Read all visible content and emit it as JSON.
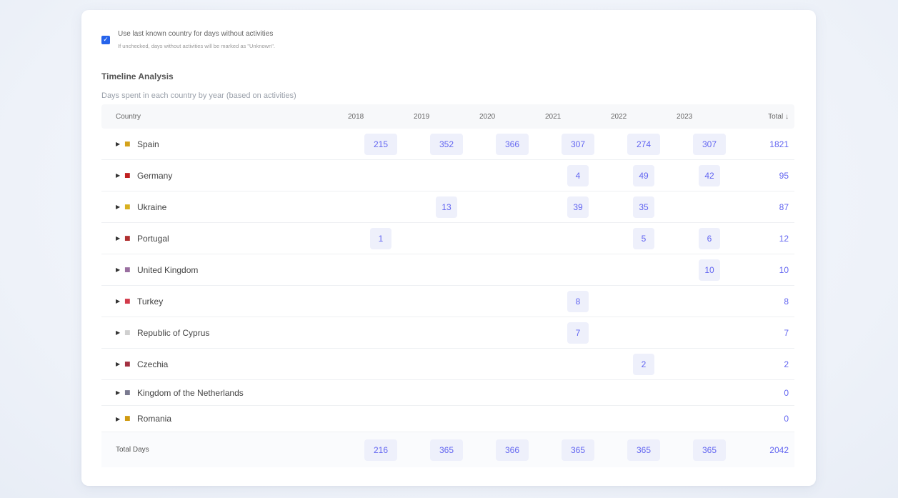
{
  "options": {
    "use_last_known_label": "Use last known country for days without activities",
    "use_last_known_help": "If unchecked, days without activities will be marked as \"Unknown\".",
    "use_last_known_checked": true
  },
  "timeline": {
    "title": "Timeline Analysis",
    "subtitle": "Days spent in each country by year (based on activities)"
  },
  "table": {
    "headers": {
      "country": "Country",
      "years": [
        "2018",
        "2019",
        "2020",
        "2021",
        "2022",
        "2023"
      ],
      "total": "Total ↓"
    },
    "rows": [
      {
        "flag": "■",
        "flag_color": "#d4a21a",
        "country": "Spain",
        "values": [
          "215",
          "352",
          "366",
          "307",
          "274",
          "307"
        ],
        "total": "1821"
      },
      {
        "flag": "■",
        "flag_color": "#c02020",
        "country": "Germany",
        "values": [
          "",
          "",
          "",
          "4",
          "49",
          "42"
        ],
        "total": "95"
      },
      {
        "flag": "■",
        "flag_color": "#d8b020",
        "country": "Ukraine",
        "values": [
          "",
          "13",
          "",
          "39",
          "35",
          ""
        ],
        "total": "87"
      },
      {
        "flag": "■",
        "flag_color": "#b03030",
        "country": "Portugal",
        "values": [
          "1",
          "",
          "",
          "",
          "5",
          "6"
        ],
        "total": "12"
      },
      {
        "flag": "■",
        "flag_color": "#9a6fa0",
        "country": "United Kingdom",
        "values": [
          "",
          "",
          "",
          "",
          "",
          "10"
        ],
        "total": "10"
      },
      {
        "flag": "■",
        "flag_color": "#d23a4a",
        "country": "Turkey",
        "values": [
          "",
          "",
          "",
          "8",
          "",
          ""
        ],
        "total": "8"
      },
      {
        "flag": "■",
        "flag_color": "#d0d0d0",
        "country": "Republic of Cyprus",
        "values": [
          "",
          "",
          "",
          "7",
          "",
          ""
        ],
        "total": "7"
      },
      {
        "flag": "■",
        "flag_color": "#a33040",
        "country": "Czechia",
        "values": [
          "",
          "",
          "",
          "",
          "2",
          ""
        ],
        "total": "2"
      },
      {
        "flag": "■",
        "flag_color": "#7a7a90",
        "country": "Kingdom of the Netherlands",
        "values": [
          "",
          "",
          "",
          "",
          "",
          ""
        ],
        "total": "0"
      },
      {
        "flag": "■",
        "flag_color": "#d09a10",
        "country": "Romania",
        "values": [
          "",
          "",
          "",
          "",
          "",
          ""
        ],
        "total": "0"
      }
    ],
    "footer": {
      "label": "Total Days",
      "values": [
        "216",
        "365",
        "366",
        "365",
        "365",
        "365"
      ],
      "total": "2042"
    }
  },
  "colors": {
    "accent": "#6366f1",
    "pill_bg": "#eef0fb",
    "checkbox": "#2563eb"
  }
}
